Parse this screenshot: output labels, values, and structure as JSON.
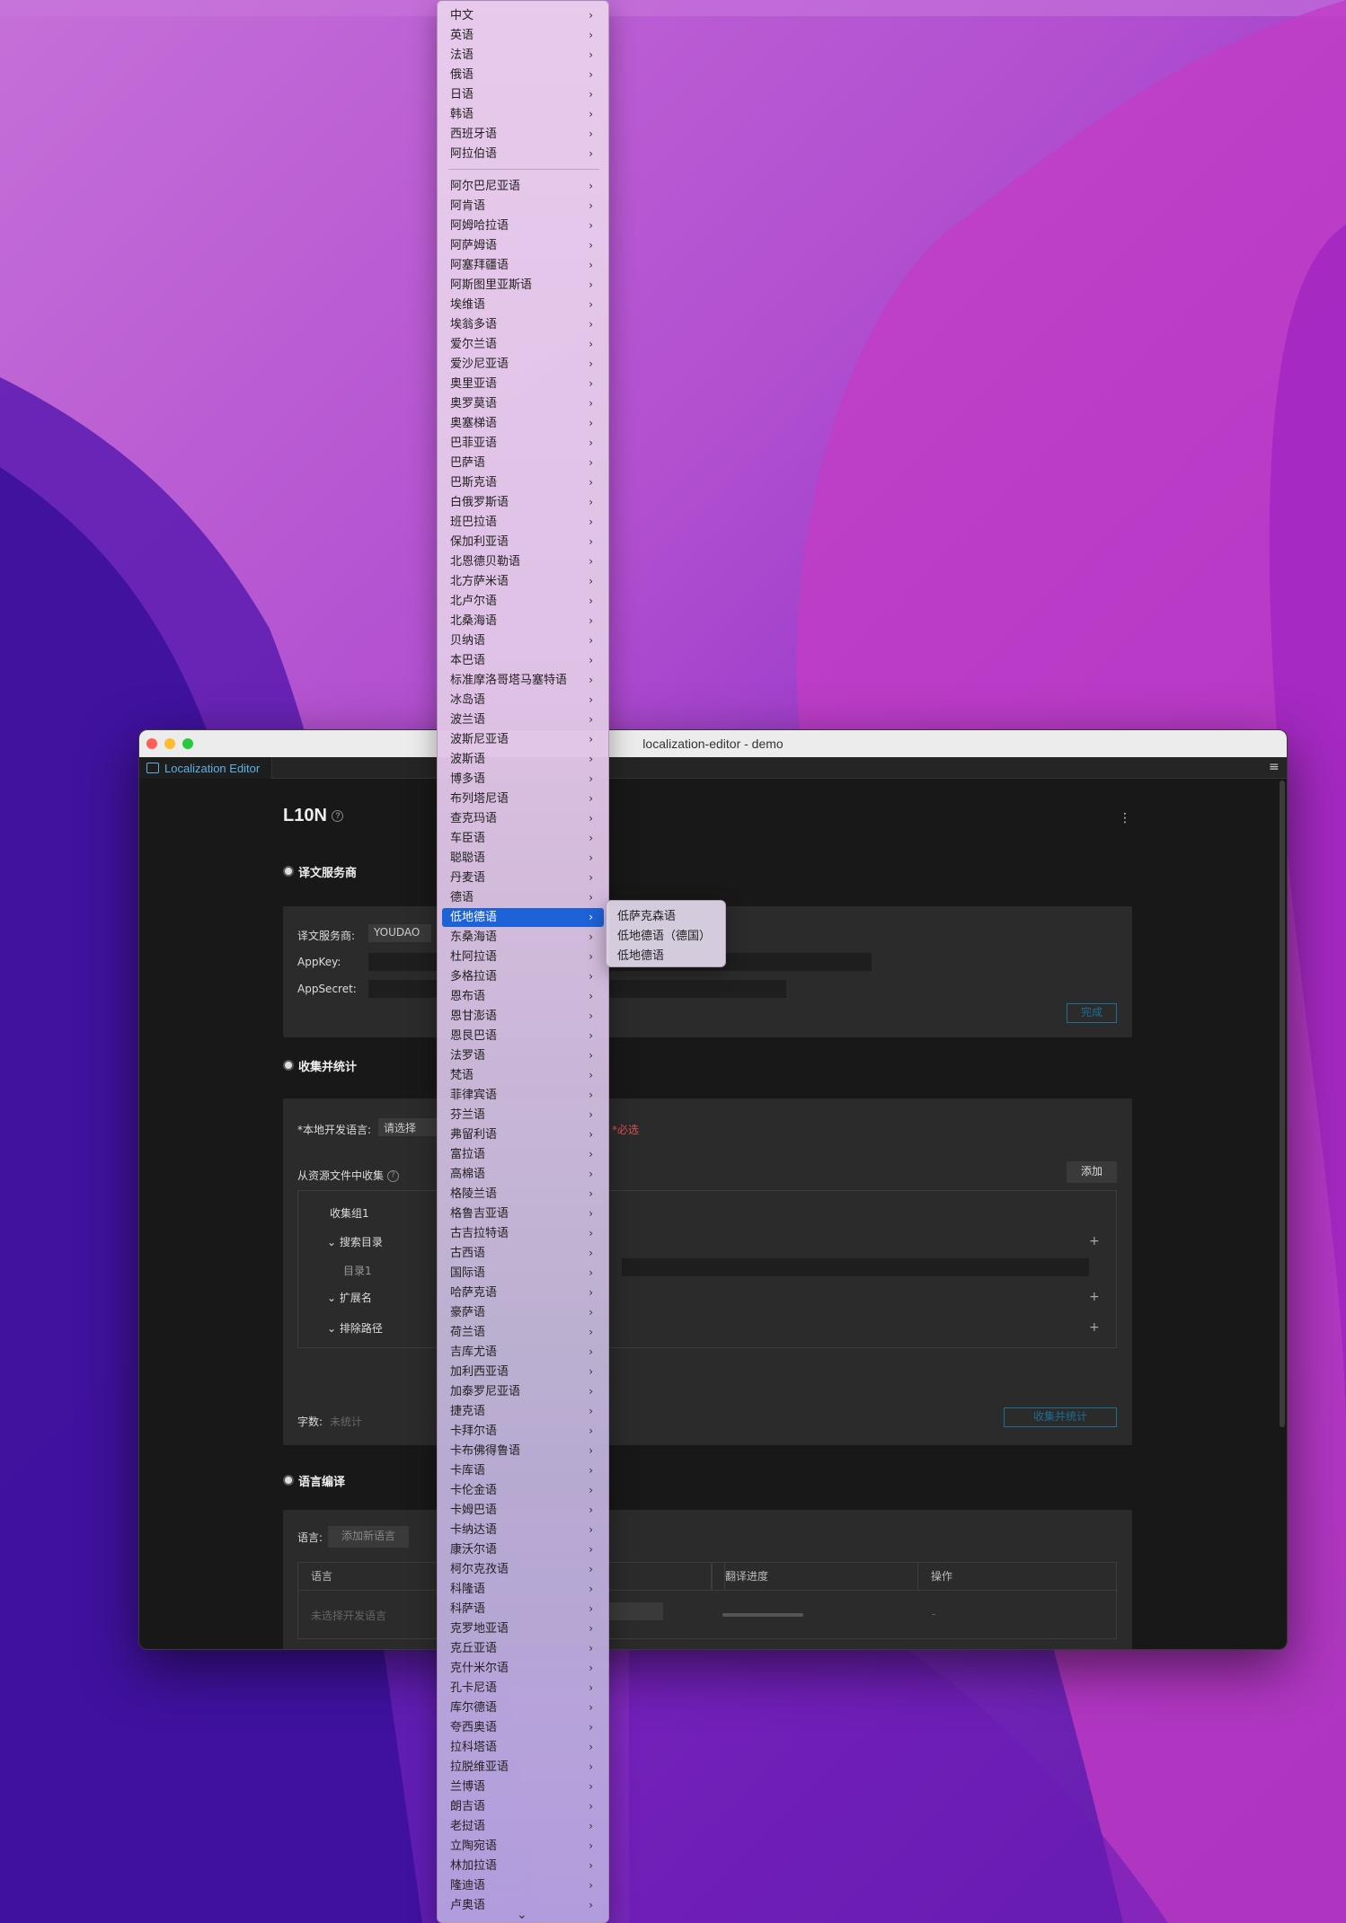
{
  "window": {
    "title": "localization-editor - demo",
    "tab_label": "Localization Editor"
  },
  "page": {
    "title": "L10N",
    "help_glyph": "?",
    "more_glyph": "⋮"
  },
  "provider_section": {
    "title": "译文服务商",
    "provider_label": "译文服务商:",
    "provider_value": "YOUDAO",
    "appkey_label": "AppKey:",
    "appsecret_label": "AppSecret:",
    "done_button": "完成"
  },
  "collect_section": {
    "title": "收集并统计",
    "dev_lang_label": "*本地开发语言:",
    "dev_lang_value": "请选择",
    "required_text": "*必选",
    "from_resources_label": "从资源文件中收集",
    "add_button": "添加",
    "group_name": "收集组1",
    "search_dir_label": "搜索目录",
    "dir_name": "目录1",
    "ext_label": "扩展名",
    "exclude_label": "排除路径",
    "word_count_label": "字数:",
    "word_count_value": "未统计",
    "collect_button": "收集并统计"
  },
  "compile_section": {
    "title": "语言编译",
    "lang_label": "语言:",
    "add_lang_button": "添加新语言",
    "columns": [
      "语言",
      "",
      "翻译进度",
      "操作"
    ],
    "row": {
      "lang": "未选择开发语言",
      "action": "-"
    }
  },
  "menu": {
    "top_items": [
      "中文",
      "英语",
      "法语",
      "俄语",
      "日语",
      "韩语",
      "西班牙语",
      "阿拉伯语"
    ],
    "items": [
      "阿尔巴尼亚语",
      "阿肯语",
      "阿姆哈拉语",
      "阿萨姆语",
      "阿塞拜疆语",
      "阿斯图里亚斯语",
      "埃维语",
      "埃翁多语",
      "爱尔兰语",
      "爱沙尼亚语",
      "奥里亚语",
      "奥罗莫语",
      "奥塞梯语",
      "巴菲亚语",
      "巴萨语",
      "巴斯克语",
      "白俄罗斯语",
      "班巴拉语",
      "保加利亚语",
      "北恩德贝勒语",
      "北方萨米语",
      "北卢尔语",
      "北桑海语",
      "贝纳语",
      "本巴语",
      "标准摩洛哥塔马塞特语",
      "冰岛语",
      "波兰语",
      "波斯尼亚语",
      "波斯语",
      "博多语",
      "布列塔尼语",
      "查克玛语",
      "车臣语",
      "聪聪语",
      "丹麦语",
      "德语",
      "低地德语",
      "东桑海语",
      "杜阿拉语",
      "多格拉语",
      "恩布语",
      "恩甘澎语",
      "恩艮巴语",
      "法罗语",
      "梵语",
      "菲律宾语",
      "芬兰语",
      "弗留利语",
      "富拉语",
      "高棉语",
      "格陵兰语",
      "格鲁吉亚语",
      "古吉拉特语",
      "古西语",
      "国际语",
      "哈萨克语",
      "豪萨语",
      "荷兰语",
      "吉库尤语",
      "加利西亚语",
      "加泰罗尼亚语",
      "捷克语",
      "卡拜尔语",
      "卡布佛得鲁语",
      "卡库语",
      "卡伦金语",
      "卡姆巴语",
      "卡纳达语",
      "康沃尔语",
      "柯尔克孜语",
      "科隆语",
      "科萨语",
      "克罗地亚语",
      "克丘亚语",
      "克什米尔语",
      "孔卡尼语",
      "库尔德语",
      "夸西奥语",
      "拉科塔语",
      "拉脱维亚语",
      "兰博语",
      "朗吉语",
      "老挝语",
      "立陶宛语",
      "林加拉语",
      "隆迪语",
      "卢奥语"
    ],
    "selected": "低地德语",
    "chevron": "›",
    "more": "⌄"
  },
  "submenu": {
    "items": [
      "低萨克森语",
      "低地德语（德国）",
      "低地德语"
    ]
  }
}
